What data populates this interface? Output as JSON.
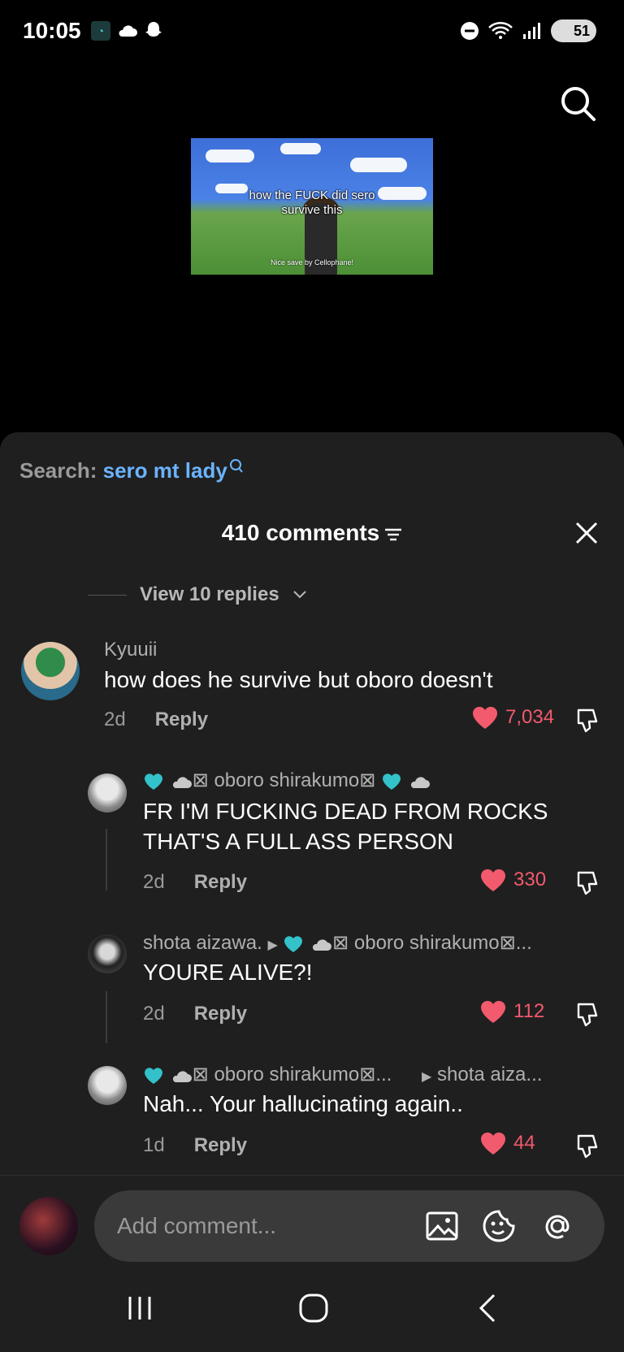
{
  "status_bar": {
    "time": "10:05",
    "battery": "51"
  },
  "video": {
    "caption": "how the FUCK did sero survive this",
    "subtitle": "Nice save by Cellophane!"
  },
  "search": {
    "prefix": "Search:",
    "keyword": "sero mt lady"
  },
  "comments_panel": {
    "title": "410 comments",
    "view_replies": "View 10 replies"
  },
  "comments": [
    {
      "user": "Kyuuii",
      "text": "how does he survive but oboro doesn't",
      "age": "2d",
      "reply": "Reply",
      "likes": "7,034"
    },
    {
      "user": "oboro shirakumo",
      "text_lines": [
        "FR I'M FUCKING DEAD FROM ROCKS",
        "THAT'S A FULL ASS PERSON"
      ],
      "age": "2d",
      "reply": "Reply",
      "likes": "330"
    },
    {
      "user": "shota aizawa.",
      "reply_to": "oboro shirakumo",
      "text": "YOURE ALIVE?!",
      "age": "2d",
      "reply": "Reply",
      "likes": "112"
    },
    {
      "user": "oboro shirakumo",
      "reply_to": "shota aiza...",
      "text": "Nah... Your hallucinating again..",
      "age": "1d",
      "reply": "Reply",
      "likes": "44"
    }
  ],
  "input": {
    "placeholder": "Add comment..."
  },
  "icons": {
    "search": "search-icon",
    "filter": "filter-icon",
    "close": "close-icon",
    "like": "heart-icon",
    "dislike": "dislike-icon",
    "image": "image-icon",
    "emoji": "emoji-icon",
    "mention": "at-icon",
    "nav_recent": "recent-apps-icon",
    "nav_home": "home-icon",
    "nav_back": "back-icon"
  },
  "colors": {
    "accent_link": "#6bb3ff",
    "like": "#f25a6d",
    "sheet_bg": "#1f1f1f"
  }
}
